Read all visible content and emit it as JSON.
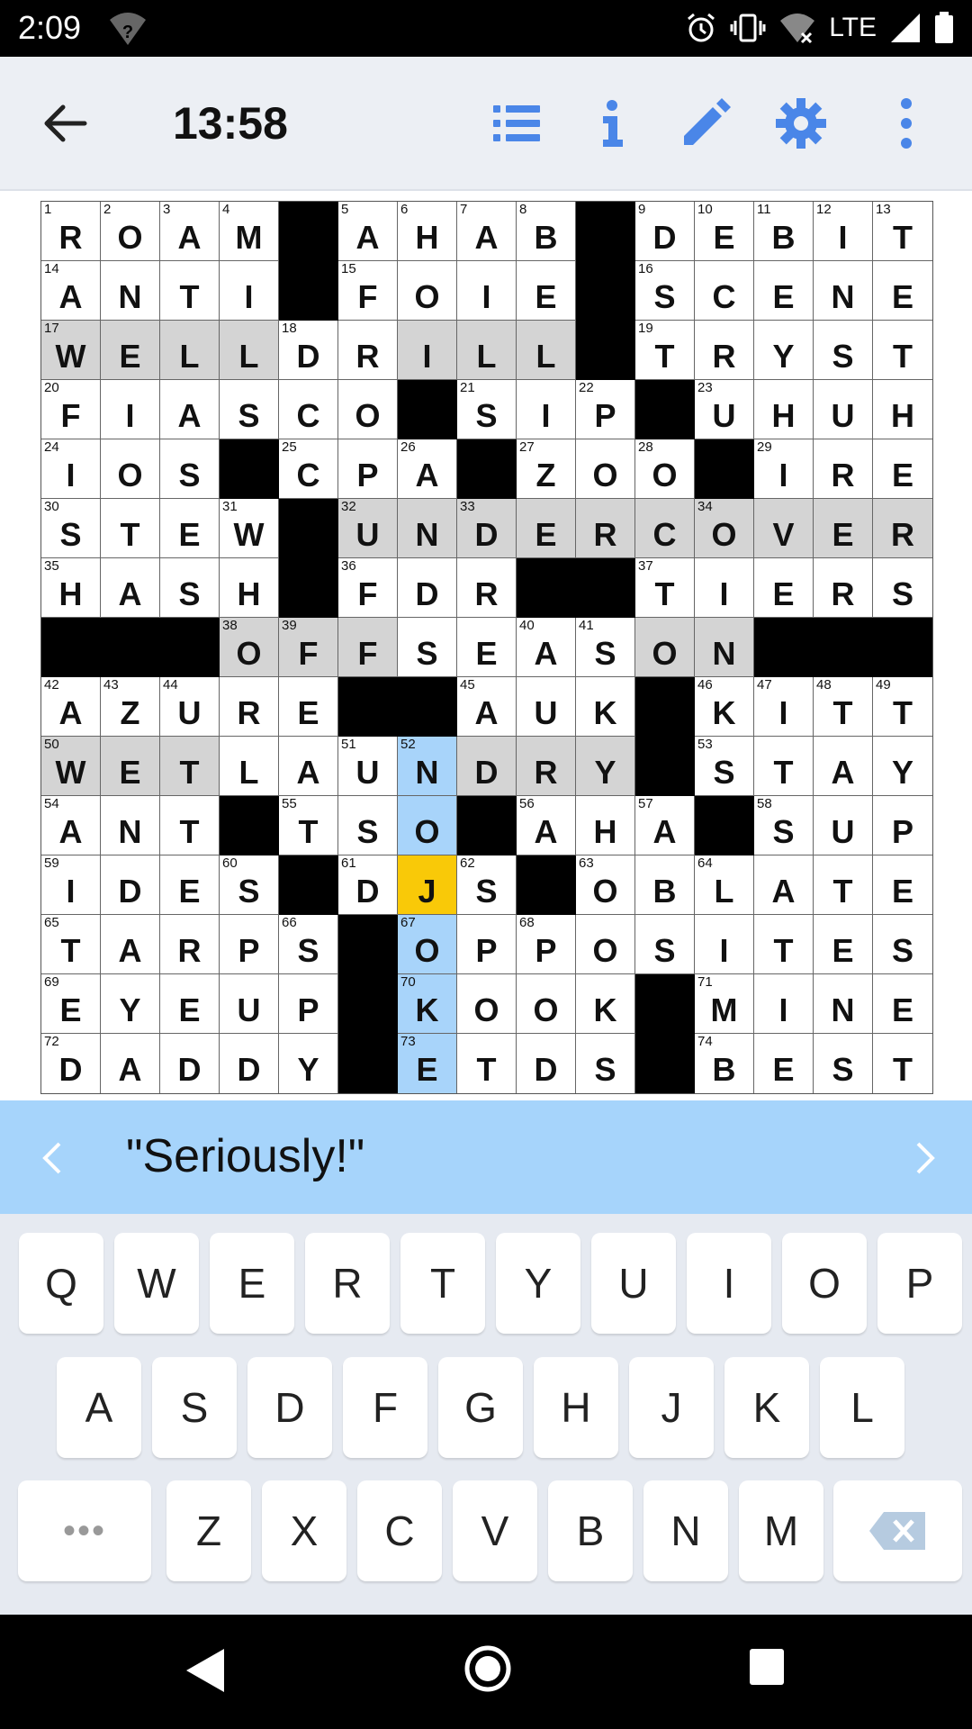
{
  "status_bar": {
    "time": "2:09",
    "network": "LTE"
  },
  "toolbar": {
    "timer": "13:58",
    "icons": [
      "back-arrow-icon",
      "clue-list-icon",
      "info-icon",
      "pencil-icon",
      "settings-gear-icon",
      "more-vert-icon"
    ],
    "accent_color": "#4a86e8"
  },
  "puzzle": {
    "rows": [
      "ROAM#AHAB#DEBIT",
      "ANTI#FOIE#SCENE",
      "WELLDRILL#TRYST",
      "FIASCO#SIP#UHUH",
      "IOS#CPA#ZOO#IRE",
      "STEW#UNDERCOVER",
      "HASH#FDR##TIERS",
      "###OFFSEASON###",
      "AZURE##AUK#KITT",
      "WETLAUNDRY#STAY",
      "ANT#TSO#AHA#SUP",
      "IDES#DJS#OBLATE",
      "TARPS#OPPOSITES",
      "EYEUP#KOOK#MINE",
      "DADDY#ETDS#BEST"
    ],
    "numbers": [
      [
        1,
        2,
        3,
        4,
        0,
        5,
        6,
        7,
        8,
        0,
        9,
        10,
        11,
        12,
        13
      ],
      [
        14,
        0,
        0,
        0,
        0,
        15,
        0,
        0,
        0,
        0,
        16,
        0,
        0,
        0,
        0
      ],
      [
        17,
        0,
        0,
        0,
        18,
        0,
        0,
        0,
        0,
        0,
        19,
        0,
        0,
        0,
        0
      ],
      [
        20,
        0,
        0,
        0,
        0,
        0,
        0,
        21,
        0,
        22,
        0,
        23,
        0,
        0,
        0
      ],
      [
        24,
        0,
        0,
        0,
        25,
        0,
        26,
        0,
        27,
        0,
        28,
        0,
        29,
        0,
        0
      ],
      [
        30,
        0,
        0,
        31,
        0,
        32,
        0,
        33,
        0,
        0,
        0,
        34,
        0,
        0,
        0
      ],
      [
        35,
        0,
        0,
        0,
        0,
        36,
        0,
        0,
        0,
        0,
        37,
        0,
        0,
        0,
        0
      ],
      [
        0,
        0,
        0,
        38,
        39,
        0,
        0,
        0,
        40,
        41,
        0,
        0,
        0,
        0,
        0
      ],
      [
        42,
        43,
        44,
        0,
        0,
        0,
        0,
        45,
        0,
        0,
        0,
        46,
        47,
        48,
        49
      ],
      [
        50,
        0,
        0,
        0,
        0,
        51,
        52,
        0,
        0,
        0,
        0,
        53,
        0,
        0,
        0
      ],
      [
        54,
        0,
        0,
        0,
        55,
        0,
        0,
        0,
        56,
        0,
        57,
        0,
        58,
        0,
        0
      ],
      [
        59,
        0,
        0,
        60,
        0,
        61,
        0,
        62,
        0,
        63,
        0,
        64,
        0,
        0,
        0
      ],
      [
        65,
        0,
        0,
        0,
        66,
        0,
        67,
        0,
        68,
        0,
        0,
        0,
        0,
        0,
        0
      ],
      [
        69,
        0,
        0,
        0,
        0,
        0,
        70,
        0,
        0,
        0,
        0,
        71,
        0,
        0,
        0
      ],
      [
        72,
        0,
        0,
        0,
        0,
        0,
        73,
        0,
        0,
        0,
        0,
        74,
        0,
        0,
        0
      ]
    ],
    "highlight_word_cells": [
      "2,0",
      "2,1",
      "2,2",
      "2,3",
      "2,6",
      "2,7",
      "2,8",
      "5,5",
      "5,6",
      "5,7",
      "5,8",
      "5,9",
      "5,10",
      "5,11",
      "5,12",
      "5,13",
      "5,14",
      "7,3",
      "7,4",
      "7,5",
      "7,10",
      "7,11",
      "9,0",
      "9,1",
      "9,2",
      "9,7",
      "9,8",
      "9,9"
    ],
    "active_column_cells": [
      "9,6",
      "10,6",
      "12,6",
      "13,6",
      "14,6"
    ],
    "current_cell": "11,6",
    "colors": {
      "highlight": "#d4d4d4",
      "active": "#a8d4fa",
      "current": "#f9c908"
    }
  },
  "clue_bar": {
    "text": "\"Seriously!\""
  },
  "keyboard": {
    "row1": [
      "Q",
      "W",
      "E",
      "R",
      "T",
      "Y",
      "U",
      "I",
      "O",
      "P"
    ],
    "row2": [
      "A",
      "S",
      "D",
      "F",
      "G",
      "H",
      "J",
      "K",
      "L"
    ],
    "row3": [
      "Z",
      "X",
      "C",
      "V",
      "B",
      "N",
      "M"
    ],
    "more_key": "•••"
  }
}
